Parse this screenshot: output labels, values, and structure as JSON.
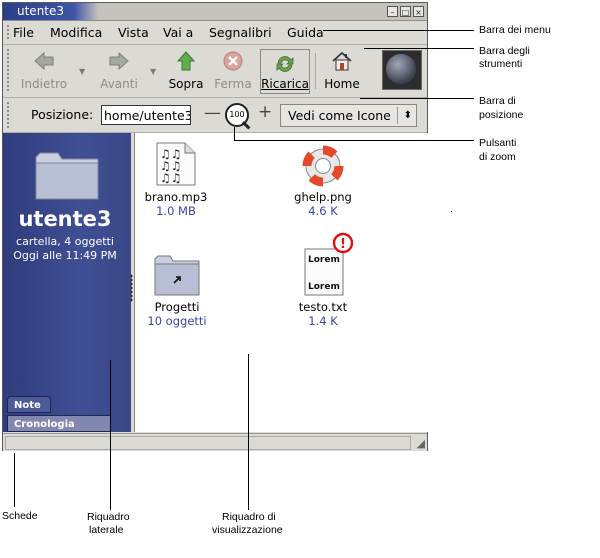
{
  "window": {
    "title": "utente3"
  },
  "menubar": {
    "items": [
      "File",
      "Modifica",
      "Vista",
      "Vai a",
      "Segnalibri",
      "Guida"
    ]
  },
  "toolbar": {
    "back_label": "Indietro",
    "forward_label": "Avanti",
    "up_label": "Sopra",
    "stop_label": "Ferma",
    "reload_label": "Ricarica",
    "home_label": "Home"
  },
  "locationbar": {
    "label": "Posizione:",
    "value": "home/utente3",
    "zoom_level": "100",
    "view_as": "Vedi come Icone"
  },
  "sidepane": {
    "name": "utente3",
    "info_line1": "cartella, 4 oggetti",
    "info_line2": "Oggi alle 11:49 PM",
    "tabs": [
      "Note",
      "Cronologia"
    ]
  },
  "files": [
    {
      "name": "brano.mp3",
      "info": "1.0 MB"
    },
    {
      "name": "ghelp.png",
      "info": "4.6 K"
    },
    {
      "name": "Progetti",
      "info": "10 oggetti"
    },
    {
      "name": "testo.txt",
      "info": "1.4 K"
    }
  ],
  "file_icon_text": "Lorem",
  "callouts": {
    "menubar": "Barra dei menu",
    "toolbar_1": "Barra degli",
    "toolbar_2": "strumenti",
    "locationbar_1": "Barra di",
    "locationbar_2": "posizione",
    "zoom_1": "Pulsanti",
    "zoom_2": "di zoom",
    "tabs": "Schede",
    "sidepane_1": "Riquadro",
    "sidepane_2": "laterale",
    "viewpane_1": "Riquadro di",
    "viewpane_2": "visualizzazione",
    "dot": "."
  },
  "colors": {
    "sidepane": "#3f4f93",
    "file_info": "#3a45a8",
    "title_accent": "#2b3e8a"
  }
}
